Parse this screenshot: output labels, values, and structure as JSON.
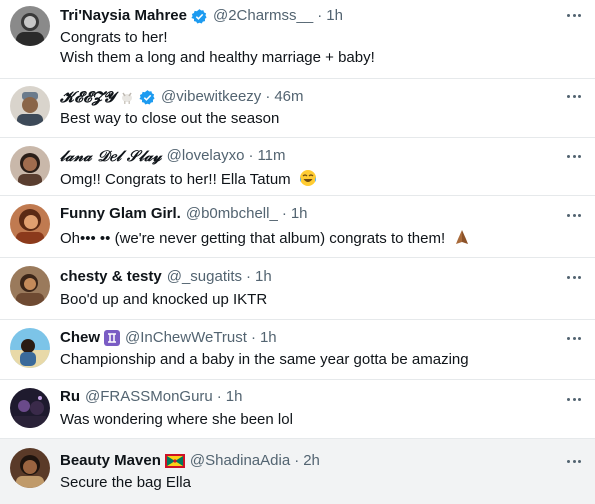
{
  "tweets": [
    {
      "name": "Tri'Naysia Mahree",
      "handle": "@2Charmss__",
      "time": "1h",
      "lines": [
        "Congrats to her!",
        "Wish them a long and healthy marriage + baby!"
      ],
      "verified": true
    },
    {
      "name": "𝓚𝓔𝓔𝓩𝓨",
      "handle": "@vibewitkeezy",
      "time": "46m",
      "lines": [
        "Best way to close out the season"
      ],
      "verified": true,
      "name_emoji": "goat-icon"
    },
    {
      "name": "𝓁𝒶𝓃𝒶 𝒟𝑒𝓁 𝒮𝓁𝒶𝓎",
      "handle": "@lovelayxo",
      "time": "11m",
      "lines": [
        "Omg!! Congrats to her!! Ella Tatum"
      ],
      "text_emoji": "laughing-crying-emoji-icon"
    },
    {
      "name": "Funny Glam Girl.",
      "handle": "@b0mbchell_",
      "time": "1h",
      "lines": [
        "Oh••• •• (we're never getting that album) congrats to them!"
      ],
      "text_emoji": "praying-hands-emoji-icon"
    },
    {
      "name": "chesty & testy",
      "handle": "@_sugatits",
      "time": "1h",
      "lines": [
        "Boo'd up and knocked up IKTR"
      ]
    },
    {
      "name": "Chew",
      "handle": "@InChewWeTrust",
      "time": "1h",
      "lines": [
        "Championship and a baby in the same year gotta be amazing"
      ],
      "name_emoji": "gemini-sign-icon"
    },
    {
      "name": "Ru",
      "handle": "@FRASSMonGuru",
      "time": "1h",
      "lines": [
        "Was wondering where she been lol"
      ]
    },
    {
      "name": "Beauty Maven",
      "handle": "@ShadinaAdia",
      "time": "2h",
      "lines": [
        "Secure the bag Ella"
      ],
      "name_emoji": "grenada-flag-icon"
    }
  ],
  "colors": {
    "text": "#0f1419",
    "secondary": "#536471",
    "verified": "#1d9bf0",
    "divider": "#e6e9eb",
    "highlight_row": "#f2f3f4"
  },
  "icons": {
    "verified": "verified-badge-icon",
    "more": "more-options-icon"
  }
}
